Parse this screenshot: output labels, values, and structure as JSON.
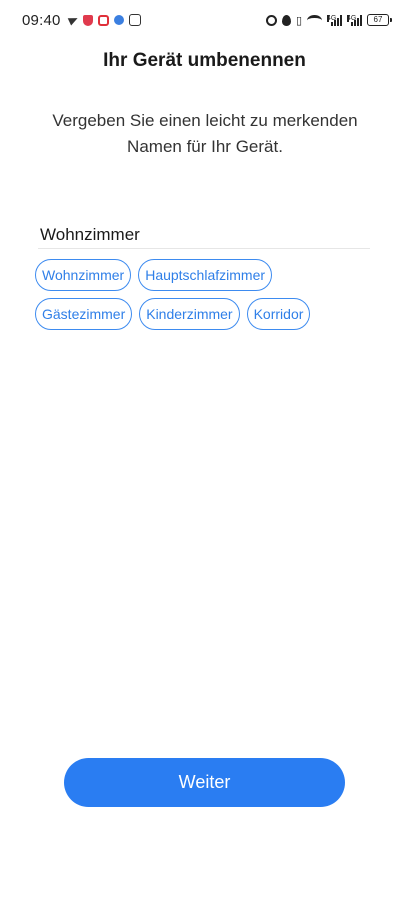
{
  "status_bar": {
    "time": "09:40",
    "battery": "67",
    "net_label_1": "4G",
    "net_label_2": "4G"
  },
  "page": {
    "title": "Ihr Gerät umbenennen",
    "subtitle": "Vergeben Sie einen leicht zu merkenden Namen für Ihr Gerät."
  },
  "name_field": {
    "value": "Wohnzimmer"
  },
  "suggestions": [
    "Wohnzimmer",
    "Hauptschlafzimmer",
    "Gästezimmer",
    "Kinderzimmer",
    "Korridor"
  ],
  "actions": {
    "next_label": "Weiter"
  },
  "colors": {
    "accent": "#2a7df2",
    "chip_border": "#3d8bf0"
  }
}
